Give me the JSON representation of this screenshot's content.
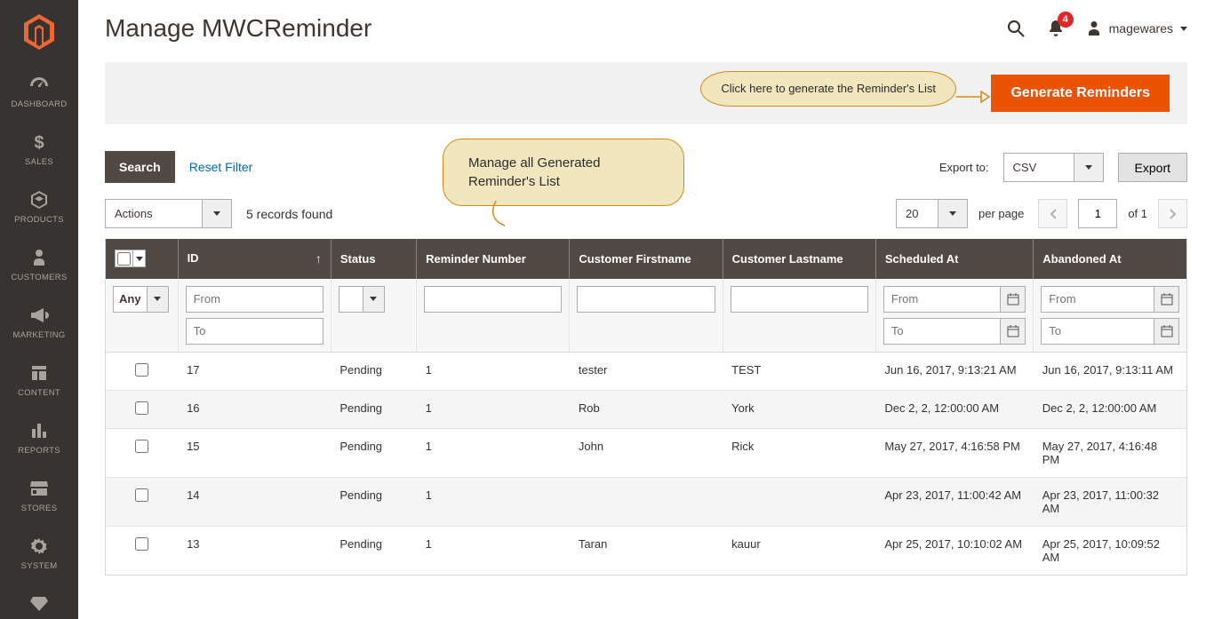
{
  "sidebar": {
    "items": [
      {
        "label": "DASHBOARD"
      },
      {
        "label": "SALES"
      },
      {
        "label": "PRODUCTS"
      },
      {
        "label": "CUSTOMERS"
      },
      {
        "label": "MARKETING"
      },
      {
        "label": "CONTENT"
      },
      {
        "label": "REPORTS"
      },
      {
        "label": "STORES"
      },
      {
        "label": "SYSTEM"
      }
    ]
  },
  "header": {
    "title": "Manage MWCReminder",
    "notifications_count": "4",
    "username": "magewares"
  },
  "action_bar": {
    "callout": "Click here to generate the Reminder's List",
    "button": "Generate Reminders"
  },
  "toolbar": {
    "search": "Search",
    "reset_filter": "Reset Filter",
    "callout": "Manage all Generated Reminder's List",
    "export_label": "Export to:",
    "export_format": "CSV",
    "export_button": "Export"
  },
  "toolbar2": {
    "actions_label": "Actions",
    "records_found": "5 records found",
    "page_size": "20",
    "per_page_label": "per page",
    "page": "1",
    "of_label": "of 1"
  },
  "grid": {
    "columns": [
      "",
      "ID",
      "Status",
      "Reminder Number",
      "Customer Firstname",
      "Customer Lastname",
      "Scheduled At",
      "Abandoned At"
    ],
    "filters": {
      "any": "Any",
      "from": "From",
      "to": "To"
    },
    "rows": [
      {
        "id": "17",
        "status": "Pending",
        "rnum": "1",
        "fn": "tester",
        "ln": "TEST",
        "sch": "Jun 16, 2017, 9:13:21 AM",
        "ab": "Jun 16, 2017, 9:13:11 AM"
      },
      {
        "id": "16",
        "status": "Pending",
        "rnum": "1",
        "fn": "Rob",
        "ln": "York",
        "sch": "Dec 2, 2, 12:00:00 AM",
        "ab": "Dec 2, 2, 12:00:00 AM"
      },
      {
        "id": "15",
        "status": "Pending",
        "rnum": "1",
        "fn": "John",
        "ln": "Rick",
        "sch": "May 27, 2017, 4:16:58 PM",
        "ab": "May 27, 2017, 4:16:48 PM"
      },
      {
        "id": "14",
        "status": "Pending",
        "rnum": "1",
        "fn": "",
        "ln": "",
        "sch": "Apr 23, 2017, 11:00:42 AM",
        "ab": "Apr 23, 2017, 11:00:32 AM"
      },
      {
        "id": "13",
        "status": "Pending",
        "rnum": "1",
        "fn": "Taran",
        "ln": "kauur",
        "sch": "Apr 25, 2017, 10:10:02 AM",
        "ab": "Apr 25, 2017, 10:09:52 AM"
      }
    ]
  }
}
